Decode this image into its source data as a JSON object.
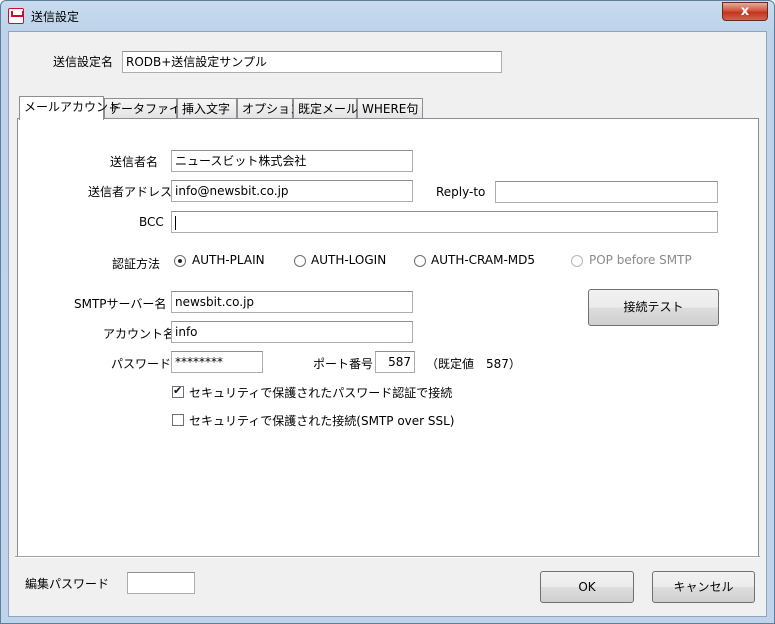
{
  "window": {
    "title": "送信設定",
    "close_glyph": "x"
  },
  "header": {
    "name_label": "送信設定名",
    "name_value": "RODB+送信設定サンプル"
  },
  "tabs": [
    {
      "label": "メールアカウント"
    },
    {
      "label": "データファイル"
    },
    {
      "label": "挿入文字"
    },
    {
      "label": "オプション"
    },
    {
      "label": "既定メール"
    },
    {
      "label": "WHERE句"
    }
  ],
  "account": {
    "sender_name_label": "送信者名",
    "sender_name_value": "ニュースビット株式会社",
    "sender_address_label": "送信者アドレス",
    "sender_address_value": "info@newsbit.co.jp",
    "reply_to_label": "Reply-to",
    "reply_to_value": "",
    "bcc_label": "BCC",
    "bcc_value": "",
    "auth_label": "認証方法",
    "auth_options": [
      {
        "label": "AUTH-PLAIN",
        "checked": true
      },
      {
        "label": "AUTH-LOGIN",
        "checked": false
      },
      {
        "label": "AUTH-CRAM-MD5",
        "checked": false
      },
      {
        "label": "POP before SMTP",
        "checked": false,
        "disabled": true
      }
    ],
    "smtp_label": "SMTPサーバー名",
    "smtp_value": "newsbit.co.jp",
    "test_button": "接続テスト",
    "account_label": "アカウント名",
    "account_value": "info",
    "password_label": "パスワード",
    "password_value": "********",
    "port_label": "ポート番号",
    "port_value": "587",
    "port_default": "（既定値　587）",
    "secure_auth_label": "セキュリティで保護されたパスワード認証で接続",
    "secure_auth_checked": true,
    "ssl_label": "セキュリティで保護された接続(SMTP over SSL)",
    "ssl_checked": false
  },
  "footer": {
    "edit_password_label": "編集パスワード",
    "edit_password_value": "",
    "ok_button": "OK",
    "cancel_button": "キャンセル"
  }
}
